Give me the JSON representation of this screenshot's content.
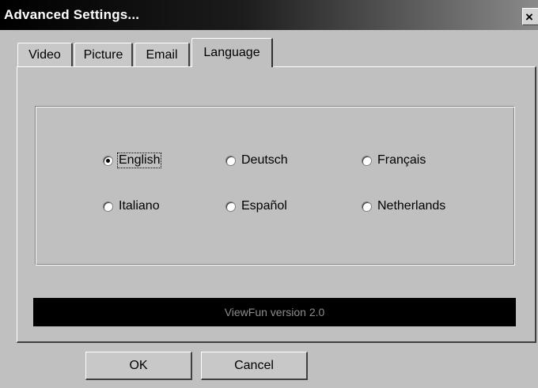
{
  "window": {
    "title": "Advanced Settings...",
    "close_label": "×"
  },
  "tabs": [
    {
      "label": "Video",
      "active": false
    },
    {
      "label": "Picture",
      "active": false
    },
    {
      "label": "Email",
      "active": false
    },
    {
      "label": "Language",
      "active": true
    }
  ],
  "languages": [
    {
      "label": "English",
      "selected": true
    },
    {
      "label": "Deutsch",
      "selected": false
    },
    {
      "label": "Français",
      "selected": false
    },
    {
      "label": "Italiano",
      "selected": false
    },
    {
      "label": "Español",
      "selected": false
    },
    {
      "label": "Netherlands",
      "selected": false
    }
  ],
  "version_text": "ViewFun version 2.0",
  "buttons": {
    "ok": "OK",
    "cancel": "Cancel"
  }
}
